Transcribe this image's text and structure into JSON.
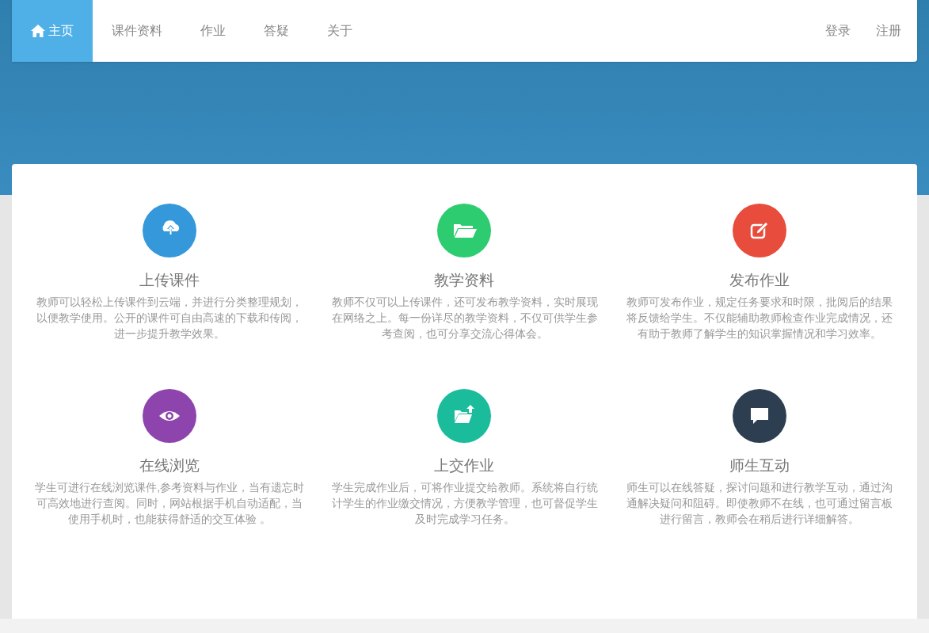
{
  "nav": {
    "items": [
      {
        "label": "主页",
        "selected": true
      },
      {
        "label": "课件资料",
        "selected": false
      },
      {
        "label": "作业",
        "selected": false
      },
      {
        "label": "答疑",
        "selected": false
      },
      {
        "label": "关于",
        "selected": false
      }
    ],
    "account": [
      "登录",
      "注册"
    ]
  },
  "features": [
    {
      "title": "上传课件",
      "color": "#3498db",
      "text": "教师可以轻松上传课件到云端，并进行分类整理规划，以便教学使用。公开的课件可自由高速的下载和传阅，进一步提升教学效果。"
    },
    {
      "title": "教学资料",
      "color": "#2ecc71",
      "text": "教师不仅可以上传课件，还可发布教学资料，实时展现在网络之上。每一份详尽的教学资料，不仅可供学生参考查阅，也可分享交流心得体会。"
    },
    {
      "title": "发布作业",
      "color": "#e74c3c",
      "text": "教师可发布作业，规定任务要求和时限，批阅后的结果将反馈给学生。不仅能辅助教师检查作业完成情况，还有助于教师了解学生的知识掌握情况和学习效率。"
    },
    {
      "title": "在线浏览",
      "color": "#8e44ad",
      "text": "学生可进行在线浏览课件,参考资料与作业，当有遗忘时可高效地进行查阅。同时，网站根据手机自动适配，当使用手机时，也能获得舒适的交互体验 。"
    },
    {
      "title": "上交作业",
      "color": "#1abc9c",
      "text": "学生完成作业后，可将作业提交给教师。系统将自行统计学生的作业缴交情况，方便教学管理，也可督促学生及时完成学习任务。"
    },
    {
      "title": "师生互动",
      "color": "#2c3e50",
      "text": "师生可以在线答疑，探讨问题和进行教学互动，通过沟通解决疑问和阻碍。即使教师不在线，也可通过留言板进行留言，教师会在稍后进行详细解答。"
    }
  ]
}
